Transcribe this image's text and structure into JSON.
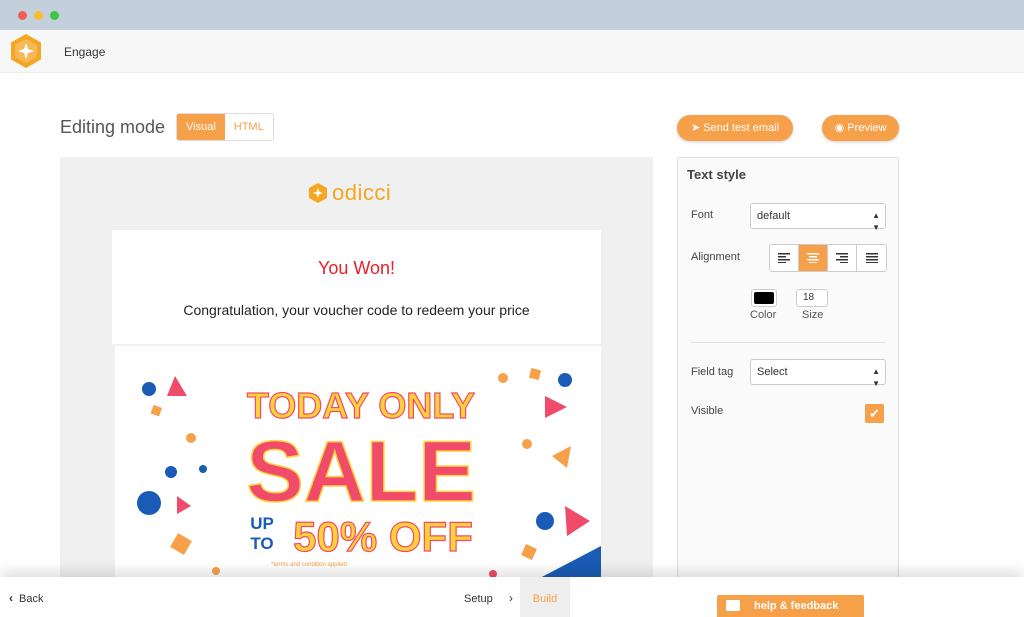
{
  "app": {
    "name": "Engage"
  },
  "editor": {
    "mode_label": "Editing mode",
    "modes": [
      {
        "label": "Visual",
        "active": true
      },
      {
        "label": "HTML",
        "active": false
      }
    ],
    "send_test_label": "Send test email",
    "preview_label": "Preview"
  },
  "email": {
    "brand_name": "odicci",
    "headline": "You Won!",
    "message": "Congratulation, your voucher code to redeem your price",
    "banner": {
      "line1": "TODAY ONLY",
      "line2": "SALE",
      "upto_line1": "UP",
      "upto_line2": "TO",
      "discount": "50% OFF",
      "fineprint": "*terms and condition applied"
    }
  },
  "panel": {
    "title": "Text style",
    "font_label": "Font",
    "font_value": "default",
    "alignment_label": "Alignment",
    "alignment_active": "center",
    "color_label": "Color",
    "color_value": "#000000",
    "size_label": "Size",
    "size_value": "18",
    "field_tag_label": "Field tag",
    "field_tag_value": "Select",
    "visible_label": "Visible",
    "visible_checked": true
  },
  "footer": {
    "back_label": "Back",
    "steps": [
      {
        "label": "Setup",
        "active": false
      },
      {
        "label": "Build",
        "active": true
      }
    ],
    "help_label": "help & feedback"
  },
  "colors": {
    "accent": "#f7a04a",
    "headline": "#e8202a",
    "sale_pink": "#f04b6b",
    "sale_yellow": "#ffd23a",
    "blue": "#1a5bb5"
  }
}
